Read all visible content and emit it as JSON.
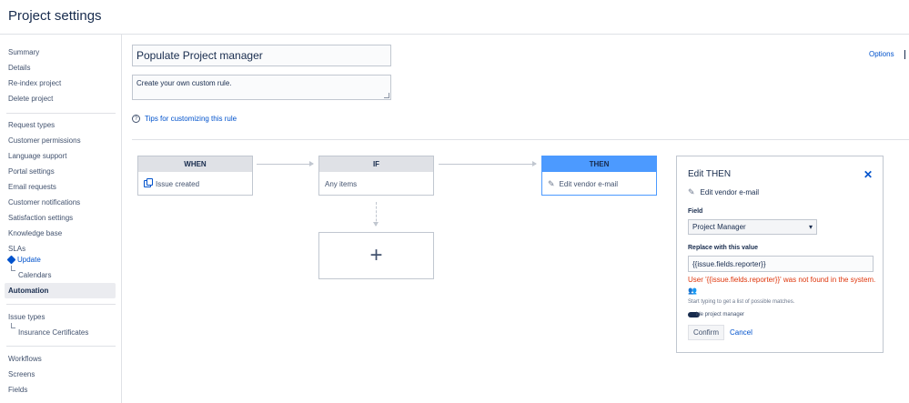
{
  "header": {
    "title": "Project settings"
  },
  "sidebar": {
    "group1": [
      "Summary",
      "Details",
      "Re-index project",
      "Delete project"
    ],
    "group2": [
      "Request types",
      "Customer permissions",
      "Language support",
      "Portal settings",
      "Email requests",
      "Customer notifications",
      "Satisfaction settings",
      "Knowledge base"
    ],
    "slas": "SLAs",
    "update": "Update",
    "calendars": "Calendars",
    "automation": "Automation",
    "issue_types": "Issue types",
    "insurance_certificates": "Insurance Certificates",
    "group4": [
      "Workflows",
      "Screens",
      "Fields"
    ]
  },
  "rule": {
    "name": "Populate Project manager",
    "description": "Create your own custom rule.",
    "tips_label": "Tips for customizing this rule",
    "options_label": "Options"
  },
  "flow": {
    "when": {
      "title": "WHEN",
      "item": "Issue created"
    },
    "if": {
      "title": "IF",
      "item": "Any items"
    },
    "then": {
      "title": "THEN",
      "item": "Edit vendor e-mail"
    },
    "add_label": "+"
  },
  "panel": {
    "title": "Edit THEN",
    "close": "✕",
    "subtitle": "Edit vendor e-mail",
    "field_label": "Field",
    "field_value": "Project Manager",
    "replace_label": "Replace with this value",
    "replace_value": "{{issue.fields.reporter}}",
    "error": "User '{{issue.fields.reporter}}' was not found in the system.",
    "hint": "Start typing to get a list of possible matches.",
    "provide_text": "ide project manager",
    "confirm_label": "Confirm",
    "cancel_label": "Cancel"
  },
  "colors": {
    "accent": "#0052cc",
    "then_header": "#4c9aff",
    "error": "#de350b"
  }
}
